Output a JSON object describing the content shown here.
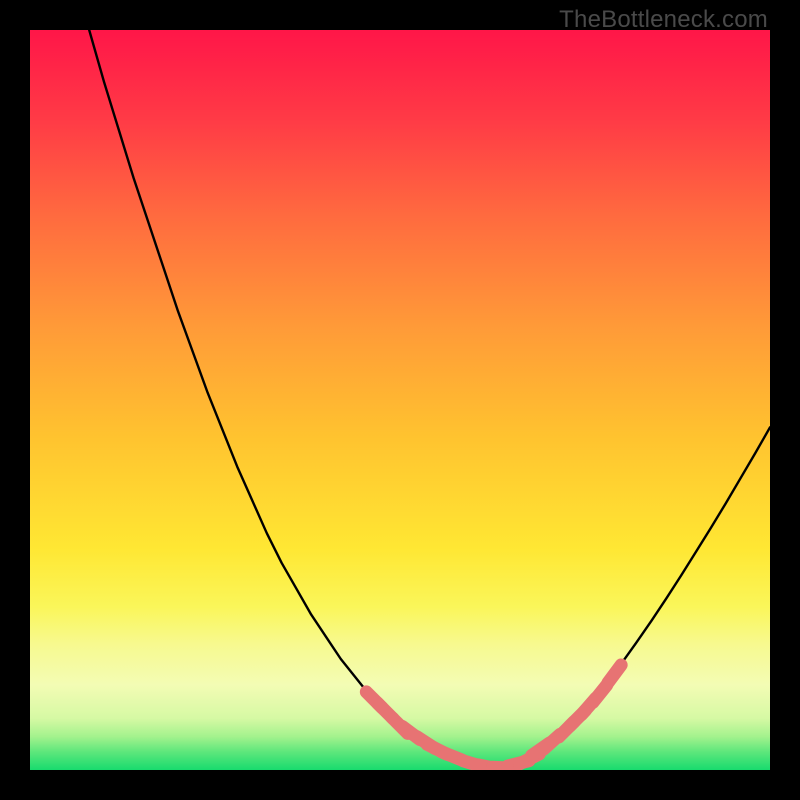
{
  "watermark": "TheBottleneck.com",
  "colors": {
    "frame": "#000000",
    "curve": "#000000",
    "marker": "#e77373",
    "gradient_stops": [
      {
        "offset": 0.0,
        "color": "#ff1648"
      },
      {
        "offset": 0.12,
        "color": "#ff3a46"
      },
      {
        "offset": 0.25,
        "color": "#ff6a3f"
      },
      {
        "offset": 0.4,
        "color": "#ff9a38"
      },
      {
        "offset": 0.55,
        "color": "#ffc32f"
      },
      {
        "offset": 0.7,
        "color": "#ffe733"
      },
      {
        "offset": 0.78,
        "color": "#faf65a"
      },
      {
        "offset": 0.83,
        "color": "#f7f98f"
      },
      {
        "offset": 0.885,
        "color": "#f3fcb4"
      },
      {
        "offset": 0.93,
        "color": "#d6f9a4"
      },
      {
        "offset": 0.955,
        "color": "#a3f28d"
      },
      {
        "offset": 0.975,
        "color": "#5fe77c"
      },
      {
        "offset": 1.0,
        "color": "#18db6e"
      }
    ]
  },
  "chart_data": {
    "type": "line",
    "title": "",
    "xlabel": "",
    "ylabel": "",
    "xlim": [
      0,
      100
    ],
    "ylim": [
      0,
      100
    ],
    "series": [
      {
        "name": "bottleneck-curve",
        "x": [
          8,
          10,
          12,
          14,
          16,
          18,
          20,
          22,
          24,
          26,
          28,
          30,
          32,
          34,
          36,
          38,
          40,
          42,
          44,
          46,
          48,
          50,
          52,
          54,
          56,
          58,
          60,
          62,
          64,
          66,
          68,
          70,
          72,
          74,
          76,
          78,
          80,
          82,
          84,
          86,
          88,
          90,
          92,
          94,
          96,
          98,
          100
        ],
        "y": [
          100,
          93,
          86.5,
          80,
          74,
          68,
          62,
          56.5,
          51,
          46,
          41,
          36.5,
          32,
          28,
          24.5,
          21,
          18,
          15,
          12.5,
          10,
          8,
          6,
          4.5,
          3.2,
          2.2,
          1.4,
          0.8,
          0.4,
          0.3,
          0.8,
          1.8,
          3.2,
          5,
          7,
          9.3,
          11.8,
          14.5,
          17.3,
          20.2,
          23.2,
          26.3,
          29.5,
          32.7,
          36,
          39.4,
          42.8,
          46.3
        ]
      }
    ],
    "markers": {
      "name": "highlighted-points",
      "x": [
        46.5,
        48,
        50,
        51.5,
        53.5,
        55,
        57,
        60,
        62,
        64,
        66,
        67.5,
        69,
        70.5,
        72.5,
        74,
        75.5,
        77,
        79
      ],
      "y": [
        9.5,
        8,
        6,
        5,
        3.7,
        2.8,
        1.9,
        0.8,
        0.4,
        0.3,
        0.9,
        1.5,
        2.8,
        3.8,
        5.5,
        7,
        8.6,
        10.3,
        13
      ]
    }
  }
}
